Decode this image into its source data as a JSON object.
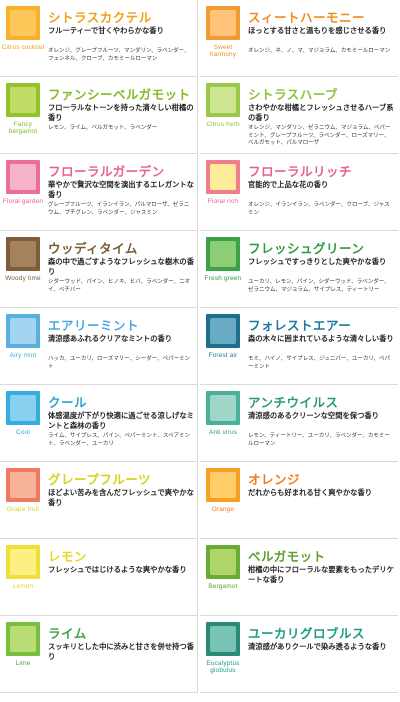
{
  "left": [
    {
      "jp": "シトラスカクテル",
      "en": "Citrus cocktail",
      "desc": "フルーティーで甘くやわらかな香り",
      "ing": "オレンジ、グレープフルーツ、マンダリン、ラベンダー、フェンネル、クローブ、カモミールローマン",
      "color": "#f0a019",
      "thumb": "#f7b12c",
      "inner": "#ffc95e"
    },
    {
      "jp": "ファンシーベルガモット",
      "en": "Fancy bergamot",
      "desc": "フローラルなトーンを持った清々しい柑橘の香り",
      "ing": "レモン、ライム、ベルガモット、ラベンダー",
      "color": "#86b923",
      "thumb": "#93c22b",
      "inner": "#c6e06c"
    },
    {
      "jp": "フローラルガーデン",
      "en": "Floral garden",
      "desc": "華やかで贅沢な空間を演出するエレガントな香り",
      "ing": "グレープフルーツ、イランイラン、パルマローザ、ゼラニウム、プチグレン、ラベンダー、ジャスミン",
      "color": "#e8608f",
      "thumb": "#ea6f99",
      "inner": "#f6b9cf"
    },
    {
      "jp": "ウッディタイム",
      "en": "Woody time",
      "desc": "森の中で過ごすようなフレッシュな樹木の香り",
      "ing": "シダーウッド、パイン、ヒノキ、ヒバ、ラベンダー、ニオイ、ベチバー",
      "color": "#7a5a36",
      "thumb": "#7f5c3a",
      "inner": "#a88662"
    },
    {
      "jp": "エアリーミント",
      "en": "Airy mint",
      "desc": "清涼感あふれるクリアなミントの香り",
      "ing": "ハッカ、ユーカリ、ローズマリー、シーダー、ペパーミント",
      "color": "#4aa8dc",
      "thumb": "#58b0de",
      "inner": "#a9d8f1"
    },
    {
      "jp": "クール",
      "en": "Cool",
      "desc": "体感温度が下がり快適に過ごせる涼しげなミントと森林の香り",
      "ing": "ライム、サイプレス、パイン、ペパーミント、スペアミント、ラベンダー、ユーカリ",
      "color": "#2aa2d8",
      "thumb": "#37acdf",
      "inner": "#8fd3f0"
    },
    {
      "jp": "グレープフルーツ",
      "en": "Grape fruit",
      "desc": "ほどよい苦みを含んだフレッシュで爽やかな香り",
      "ing": "",
      "color": "#d6d21a",
      "thumb": "#f07a5f",
      "inner": "#f9b7a0"
    },
    {
      "jp": "レモン",
      "en": "Lemon",
      "desc": "フレッシュではじけるような爽やかな香り",
      "ing": "",
      "color": "#e6d820",
      "thumb": "#f0df3a",
      "inner": "#fff08a"
    },
    {
      "jp": "ライム",
      "en": "Lime",
      "desc": "スッキリとした中に渋みと甘さを併せ持つ香り",
      "ing": "",
      "color": "#3aa64a",
      "thumb": "#78bf3c",
      "inner": "#bfe07a"
    }
  ],
  "right": [
    {
      "jp": "スィートハーモニー",
      "en": "Sweet harmony",
      "desc": "ほっとする甘さと温もりを感じさせる香り",
      "ing": "オレンジ、ネ、ノ、マ、マジョラム、カモミールローマン",
      "color": "#f08c1e",
      "thumb": "#f39a35",
      "inner": "#ffc980"
    },
    {
      "jp": "シトラスハーブ",
      "en": "Citrus herb",
      "desc": "さわやかな柑橘とフレッシュさせるハーブ系の香り",
      "ing": "オレンジ、マンダリン、ゼラニウム、マジョラム、ペパーミント、グレープフルーツ、ラベンダー、ローズマリー、ベルガモット、パルマローザ",
      "color": "#8ec03a",
      "thumb": "#9cc84a",
      "inner": "#d2e89a"
    },
    {
      "jp": "フローラルリッチ",
      "en": "Floral rich",
      "desc": "官能的で上品な花の香り",
      "ing": "オレンジ、イランイラン、ラベンダー、クローブ、ジャスミン",
      "color": "#e8608f",
      "thumb": "#ef7f8e",
      "inner": "#fff59a"
    },
    {
      "jp": "フレッシュグリーン",
      "en": "Fresh green",
      "desc": "フレッシュですっきりとした爽やかな香り",
      "ing": "ユーカリ、レモン、パイン、シダーウッド、ラベンダー、ゼラニウム、マジョラム、サイプレス、ティートリー",
      "color": "#2e9a3e",
      "thumb": "#3da149",
      "inner": "#93d07a"
    },
    {
      "jp": "フォレストエアー",
      "en": "Forest air",
      "desc": "森の木々に囲まれているような清々しい香り",
      "ing": "モミ、ハイノ、サイプレス、ジュニパー、ユーカリ、ペパーミント",
      "color": "#1a7a9a",
      "thumb": "#1f6f8c",
      "inner": "#6fb0c8"
    },
    {
      "jp": "アンチウイルス",
      "en": "Anti virus",
      "desc": "清涼感のあるクリーンな空間を保つ香り",
      "ing": "レモン、ティートリー、ユーカリ、ラベンダー、カモミールローマン",
      "color": "#2a9a7a",
      "thumb": "#4ab09a",
      "inner": "#a6d9cb"
    },
    {
      "jp": "オレンジ",
      "en": "Orange",
      "desc": "だれからも好まれる甘く爽やかな香り",
      "ing": "",
      "color": "#f07a18",
      "thumb": "#f5a024",
      "inner": "#ffd070"
    },
    {
      "jp": "ベルガモット",
      "en": "Bergamot",
      "desc": "柑橘の中にフローラルな要素をもったデリケートな香り",
      "ing": "",
      "color": "#5aa028",
      "thumb": "#6aab36",
      "inner": "#b3d86e"
    },
    {
      "jp": "ユーカリグロブルス",
      "en": "Eucalyptus globulus",
      "desc": "清涼感がありクールで染み透るような香り",
      "ing": "",
      "color": "#1c9a8a",
      "thumb": "#2a8a7a",
      "inner": "#7fc8b6"
    }
  ]
}
